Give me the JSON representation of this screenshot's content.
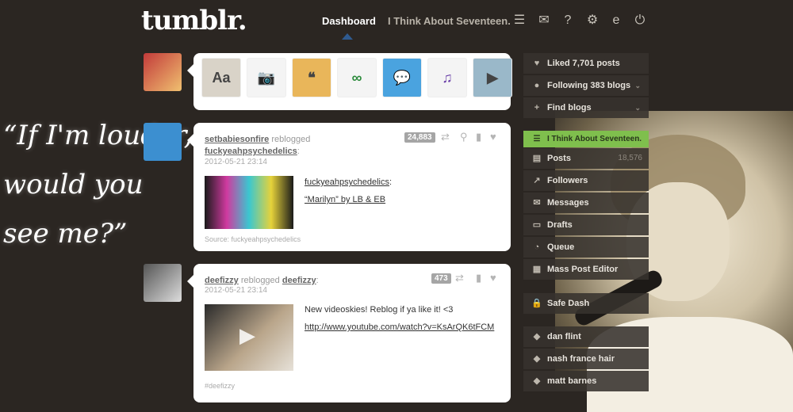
{
  "header": {
    "logo": "tumblr.",
    "nav": {
      "dashboard": "Dashboard",
      "blog": "I Think About Seventeen."
    },
    "icons": [
      "list-icon",
      "mail-icon",
      "help-icon",
      "gear-icon",
      "edit-icon",
      "power-icon"
    ]
  },
  "quote": {
    "line1": "“If I'm louder,",
    "line2": "would you see me?”"
  },
  "post_types": [
    {
      "name": "text",
      "glyph": "Aa"
    },
    {
      "name": "photo",
      "glyph": "📷"
    },
    {
      "name": "quote",
      "glyph": "❝"
    },
    {
      "name": "link",
      "glyph": "∞"
    },
    {
      "name": "chat",
      "glyph": "💬"
    },
    {
      "name": "audio",
      "glyph": "♫"
    },
    {
      "name": "video",
      "glyph": "▶"
    }
  ],
  "posts": [
    {
      "author": "setbabiesonfire",
      "action": "reblogged",
      "source_user": "fuckyeahpsychedelics",
      "date": "2012-05-21 23:14",
      "notes": "24,883",
      "body_link": "fuckyeahpsychedelics",
      "body_title": "“Marilyn” by LB & EB",
      "source": "Source: fuckyeahpsychedelics"
    },
    {
      "author": "deefizzy",
      "action": "reblogged",
      "source_user": "deefizzy",
      "date": "2012-05-21 23:14",
      "notes": "473",
      "body_text": "New videoskies! Reblog if ya like it! <3",
      "body_url": "http://www.youtube.com/watch?v=KsArQK6tFCM",
      "tag": "#deefizzy"
    }
  ],
  "sidebar": {
    "top": [
      {
        "icon": "heart-icon",
        "label": "Liked 7,701 posts"
      },
      {
        "icon": "person-icon",
        "label": "Following 383 blogs"
      },
      {
        "icon": "add-person-icon",
        "label": "Find blogs"
      }
    ],
    "blog_title": "I Think About Seventeen.",
    "blog_items": [
      {
        "icon": "posts-icon",
        "label": "Posts",
        "count": "18,576"
      },
      {
        "icon": "followers-icon",
        "label": "Followers",
        "count": ""
      },
      {
        "icon": "messages-icon",
        "label": "Messages",
        "count": ""
      },
      {
        "icon": "drafts-icon",
        "label": "Drafts",
        "count": ""
      },
      {
        "icon": "queue-icon",
        "label": "Queue",
        "count": ""
      },
      {
        "icon": "mass-edit-icon",
        "label": "Mass Post Editor",
        "count": ""
      }
    ],
    "safe": "Safe Dash",
    "tags": [
      "dan flint",
      "nash france hair",
      "matt barnes"
    ]
  },
  "colors": {
    "background": "#2b2622",
    "accent": "#7fbf4d",
    "link": "#2f5a8f"
  }
}
